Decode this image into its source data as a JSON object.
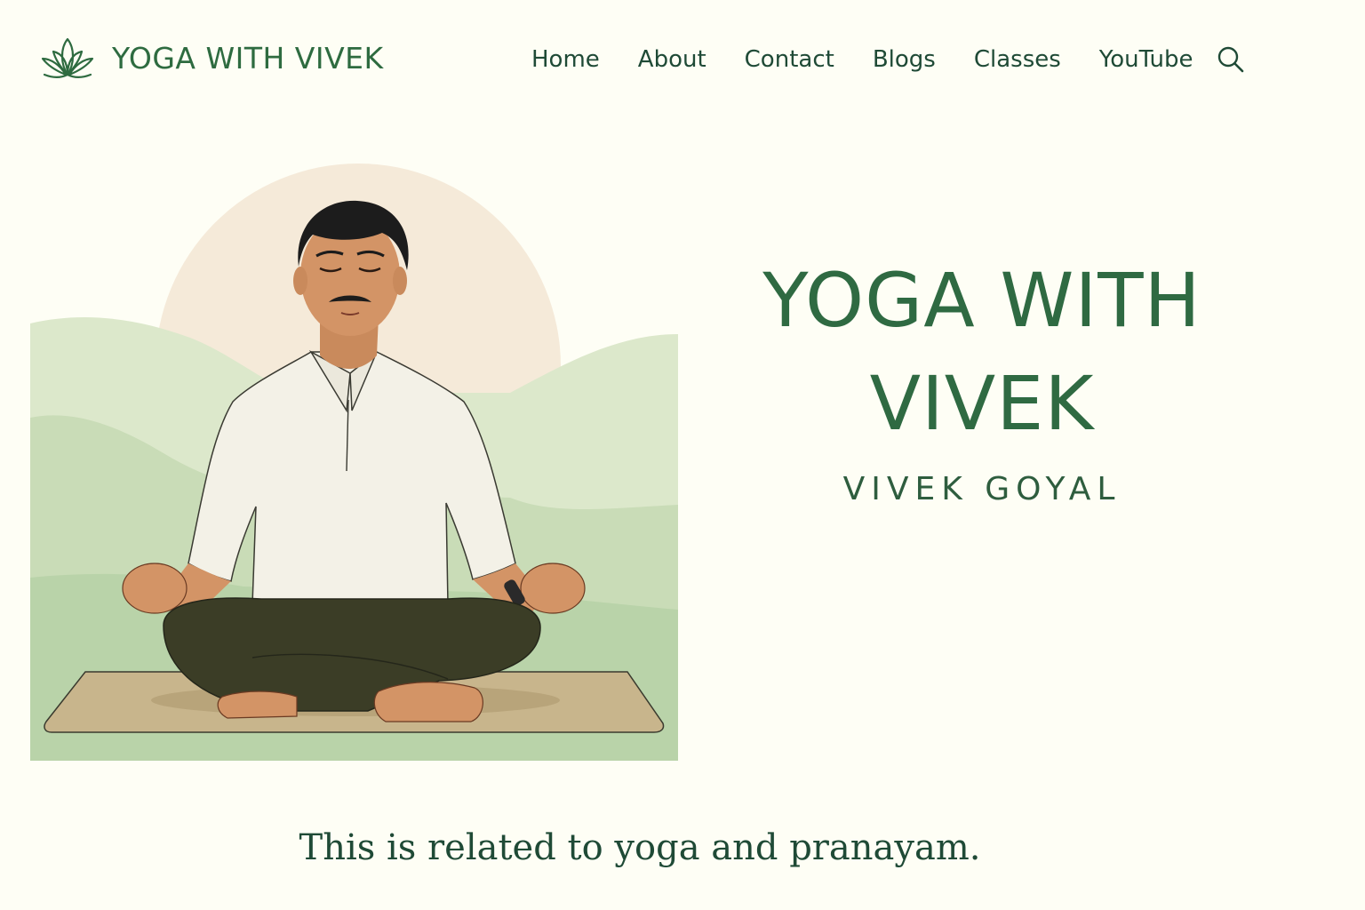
{
  "header": {
    "brand_name": "YOGA WITH VIVEK",
    "logo_icon": "lotus-icon",
    "nav": [
      {
        "label": "Home"
      },
      {
        "label": "About"
      },
      {
        "label": "Contact"
      },
      {
        "label": "Blogs"
      },
      {
        "label": "Classes"
      },
      {
        "label": "YouTube"
      }
    ],
    "search_icon": "search-icon"
  },
  "hero": {
    "title": "YOGA WITH VIVEK",
    "subtitle": "VIVEK GOYAL",
    "illustration": "man-meditating-on-yoga-mat-illustration"
  },
  "tagline": "This is related to yoga and pranayam.",
  "colors": {
    "background": "#fefef5",
    "brand_green": "#2f6a42",
    "text_dark_green": "#1f4a36",
    "hill_light": "#dce8cb",
    "hill_dark": "#b9d3a9",
    "sun": "#f5ead9",
    "mat": "#c8b58c"
  }
}
